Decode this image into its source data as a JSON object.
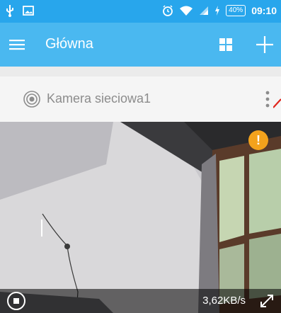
{
  "status_bar": {
    "time": "09:10",
    "battery": "40%"
  },
  "app_bar": {
    "title": "Główna"
  },
  "camera": {
    "name": "Kamera sieciowa1",
    "bitrate": "3,62KB/s",
    "warning_badge": "!"
  },
  "colors": {
    "status_bar": "#28a6ec",
    "app_bar": "#4ab8f0",
    "warning": "#f3a21c"
  }
}
